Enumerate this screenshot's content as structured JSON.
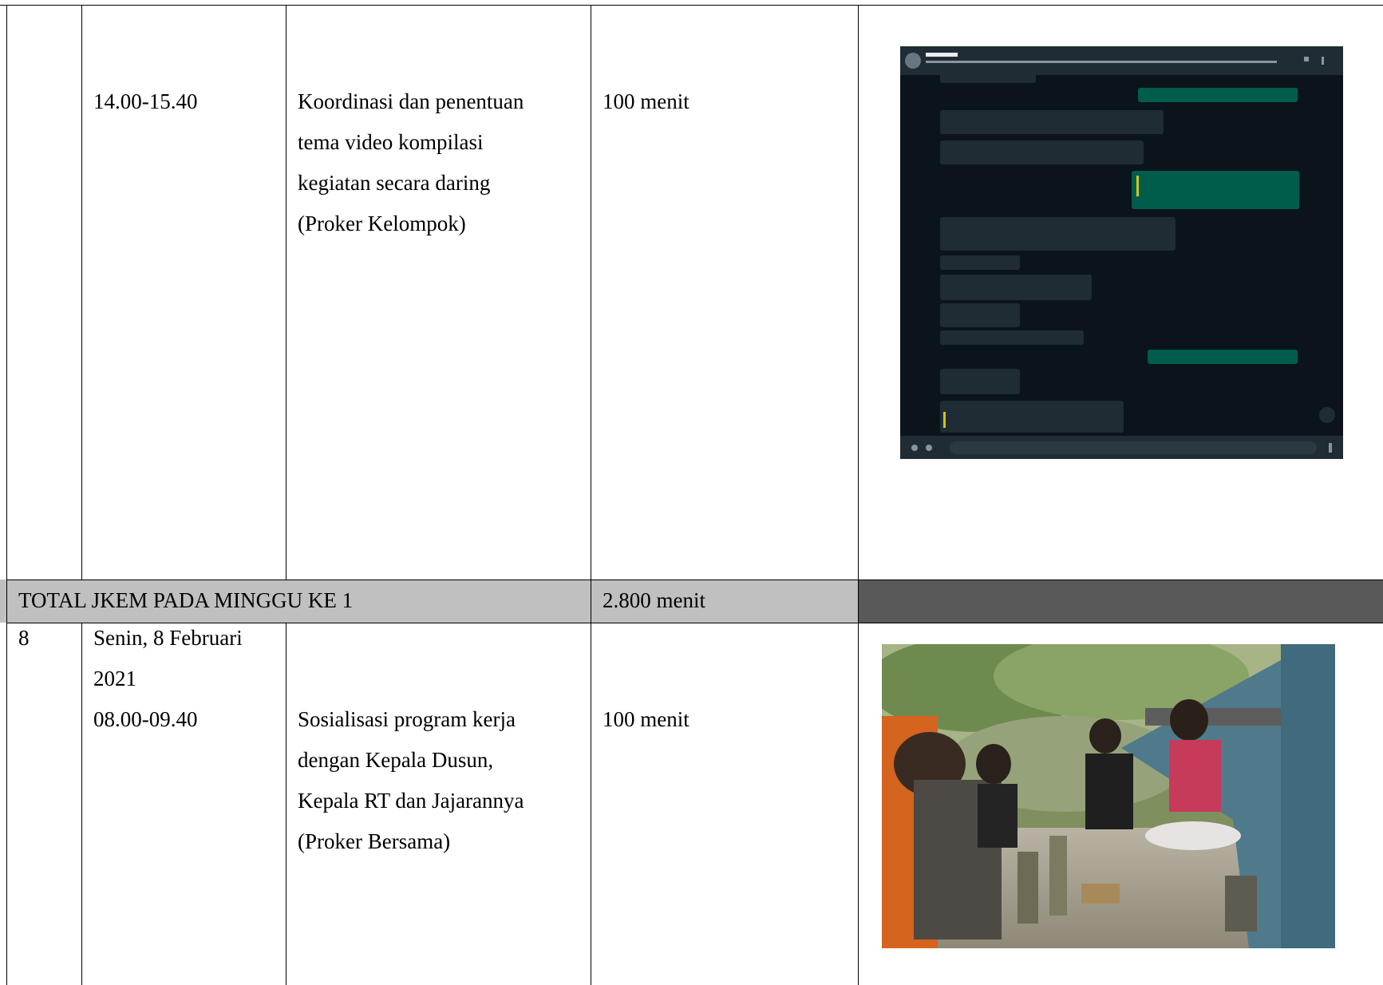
{
  "rows": [
    {
      "no": "",
      "time": "14.00-15.40",
      "activity": "Koordinasi dan penentuan\ntema video kompilasi\nkegiatan secara daring\n(Proker Kelompok)",
      "duration": "100 menit",
      "photo": "chat-screenshot"
    },
    {
      "type": "total",
      "label": "TOTAL JKEM PADA MINGGU KE 1",
      "duration": "2.800 menit"
    },
    {
      "no": "8",
      "date": "Senin, 8 Februari\n2021",
      "time": "08.00-09.40",
      "activity": "Sosialisasi program kerja\ndengan Kepala Dusun,\nKepala RT dan Jajarannya\n(Proker Bersama)",
      "duration": "100 menit",
      "photo": "meeting-photo"
    }
  ],
  "colors": {
    "total_row_bg": "#c0c0c0",
    "total_row_right_bg": "#595959",
    "chat_bg": "#0b141a",
    "chat_bubble_out": "#005c4b",
    "chat_bubble_in": "#202c33"
  }
}
